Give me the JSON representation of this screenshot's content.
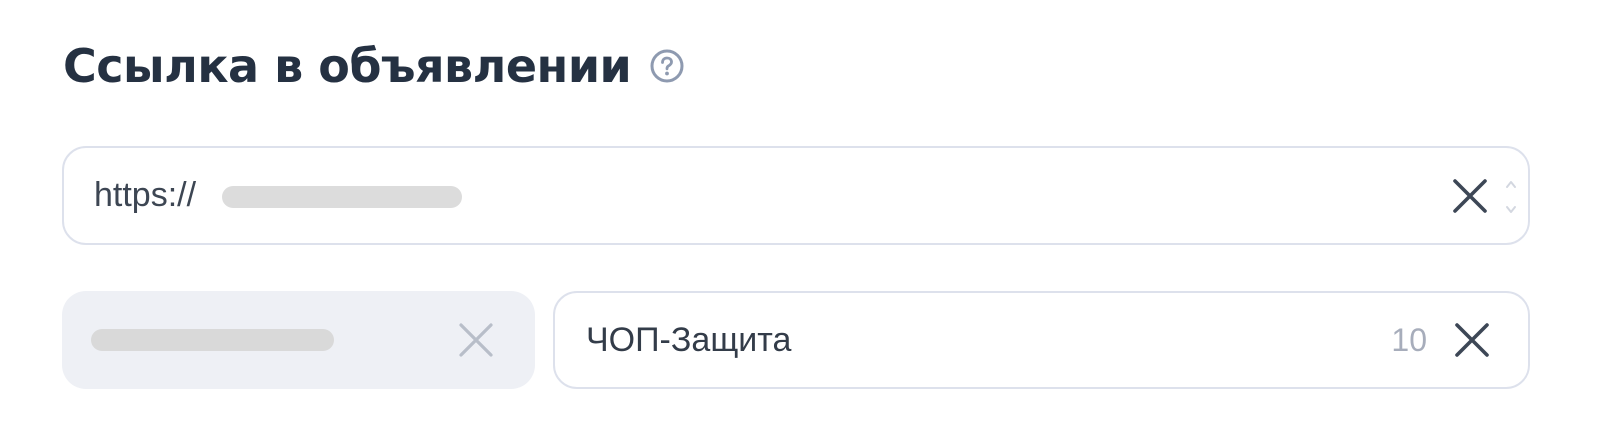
{
  "section": {
    "title": "Ссылка в объявлении",
    "help_icon": "question-circle-icon"
  },
  "url_field": {
    "prefix": "https://",
    "value_redacted": true,
    "clear_icon": "close-icon"
  },
  "domain_field": {
    "value_redacted": true,
    "clear_icon": "close-icon"
  },
  "display_link_field": {
    "value": "ЧОП-Защита",
    "remaining_chars": "10",
    "clear_icon": "close-icon"
  },
  "colors": {
    "title": "#253142",
    "field_border": "#dde1ec",
    "disabled_field_bg": "#eef0f5",
    "counter": "#a7adbb",
    "icon": "#3d4756"
  }
}
